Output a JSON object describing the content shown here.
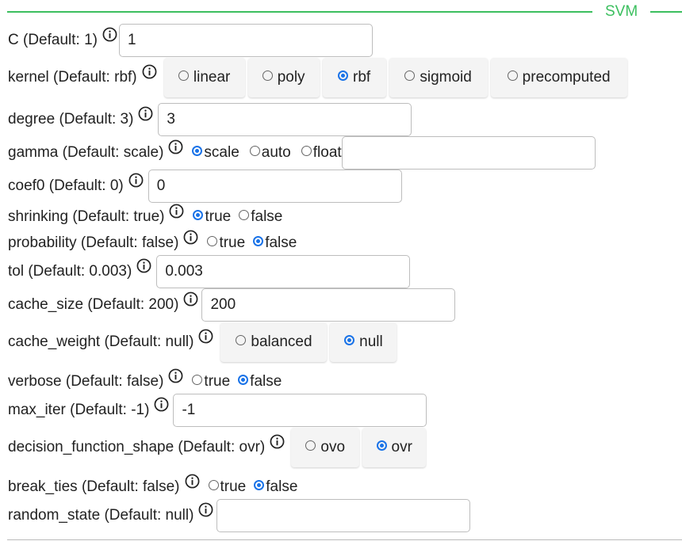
{
  "section": {
    "title": "SVM",
    "accent": "#3cbf5f"
  },
  "icons": {
    "info": "info-circle-icon"
  },
  "fields": {
    "C": {
      "label": "C (Default: 1)",
      "value": "1"
    },
    "kernel": {
      "label": "kernel (Default: rbf)",
      "options": [
        "linear",
        "poly",
        "rbf",
        "sigmoid",
        "precomputed"
      ],
      "selected": "rbf"
    },
    "degree": {
      "label": "degree (Default: 3)",
      "value": "3"
    },
    "gamma": {
      "label": "gamma (Default: scale)",
      "options": [
        "scale",
        "auto",
        "float"
      ],
      "selected": "scale",
      "value": ""
    },
    "coef0": {
      "label": "coef0 (Default: 0)",
      "value": "0"
    },
    "shrinking": {
      "label": "shrinking (Default: true)",
      "options": [
        "true",
        "false"
      ],
      "selected": "true"
    },
    "probability": {
      "label": "probability (Default: false)",
      "options": [
        "true",
        "false"
      ],
      "selected": "false"
    },
    "tol": {
      "label": "tol (Default: 0.003)",
      "value": "0.003"
    },
    "cache_size": {
      "label": "cache_size (Default: 200)",
      "value": "200"
    },
    "cache_weight": {
      "label": "cache_weight (Default: null)",
      "options": [
        "balanced",
        "null"
      ],
      "selected": "null"
    },
    "verbose": {
      "label": "verbose (Default: false)",
      "options": [
        "true",
        "false"
      ],
      "selected": "false"
    },
    "max_iter": {
      "label": "max_iter (Default: -1)",
      "value": "-1"
    },
    "decision_function_shape": {
      "label": "decision_function_shape (Default: ovr)",
      "options": [
        "ovo",
        "ovr"
      ],
      "selected": "ovr"
    },
    "break_ties": {
      "label": "break_ties (Default: false)",
      "options": [
        "true",
        "false"
      ],
      "selected": "false"
    },
    "random_state": {
      "label": "random_state (Default: null)",
      "value": ""
    }
  }
}
